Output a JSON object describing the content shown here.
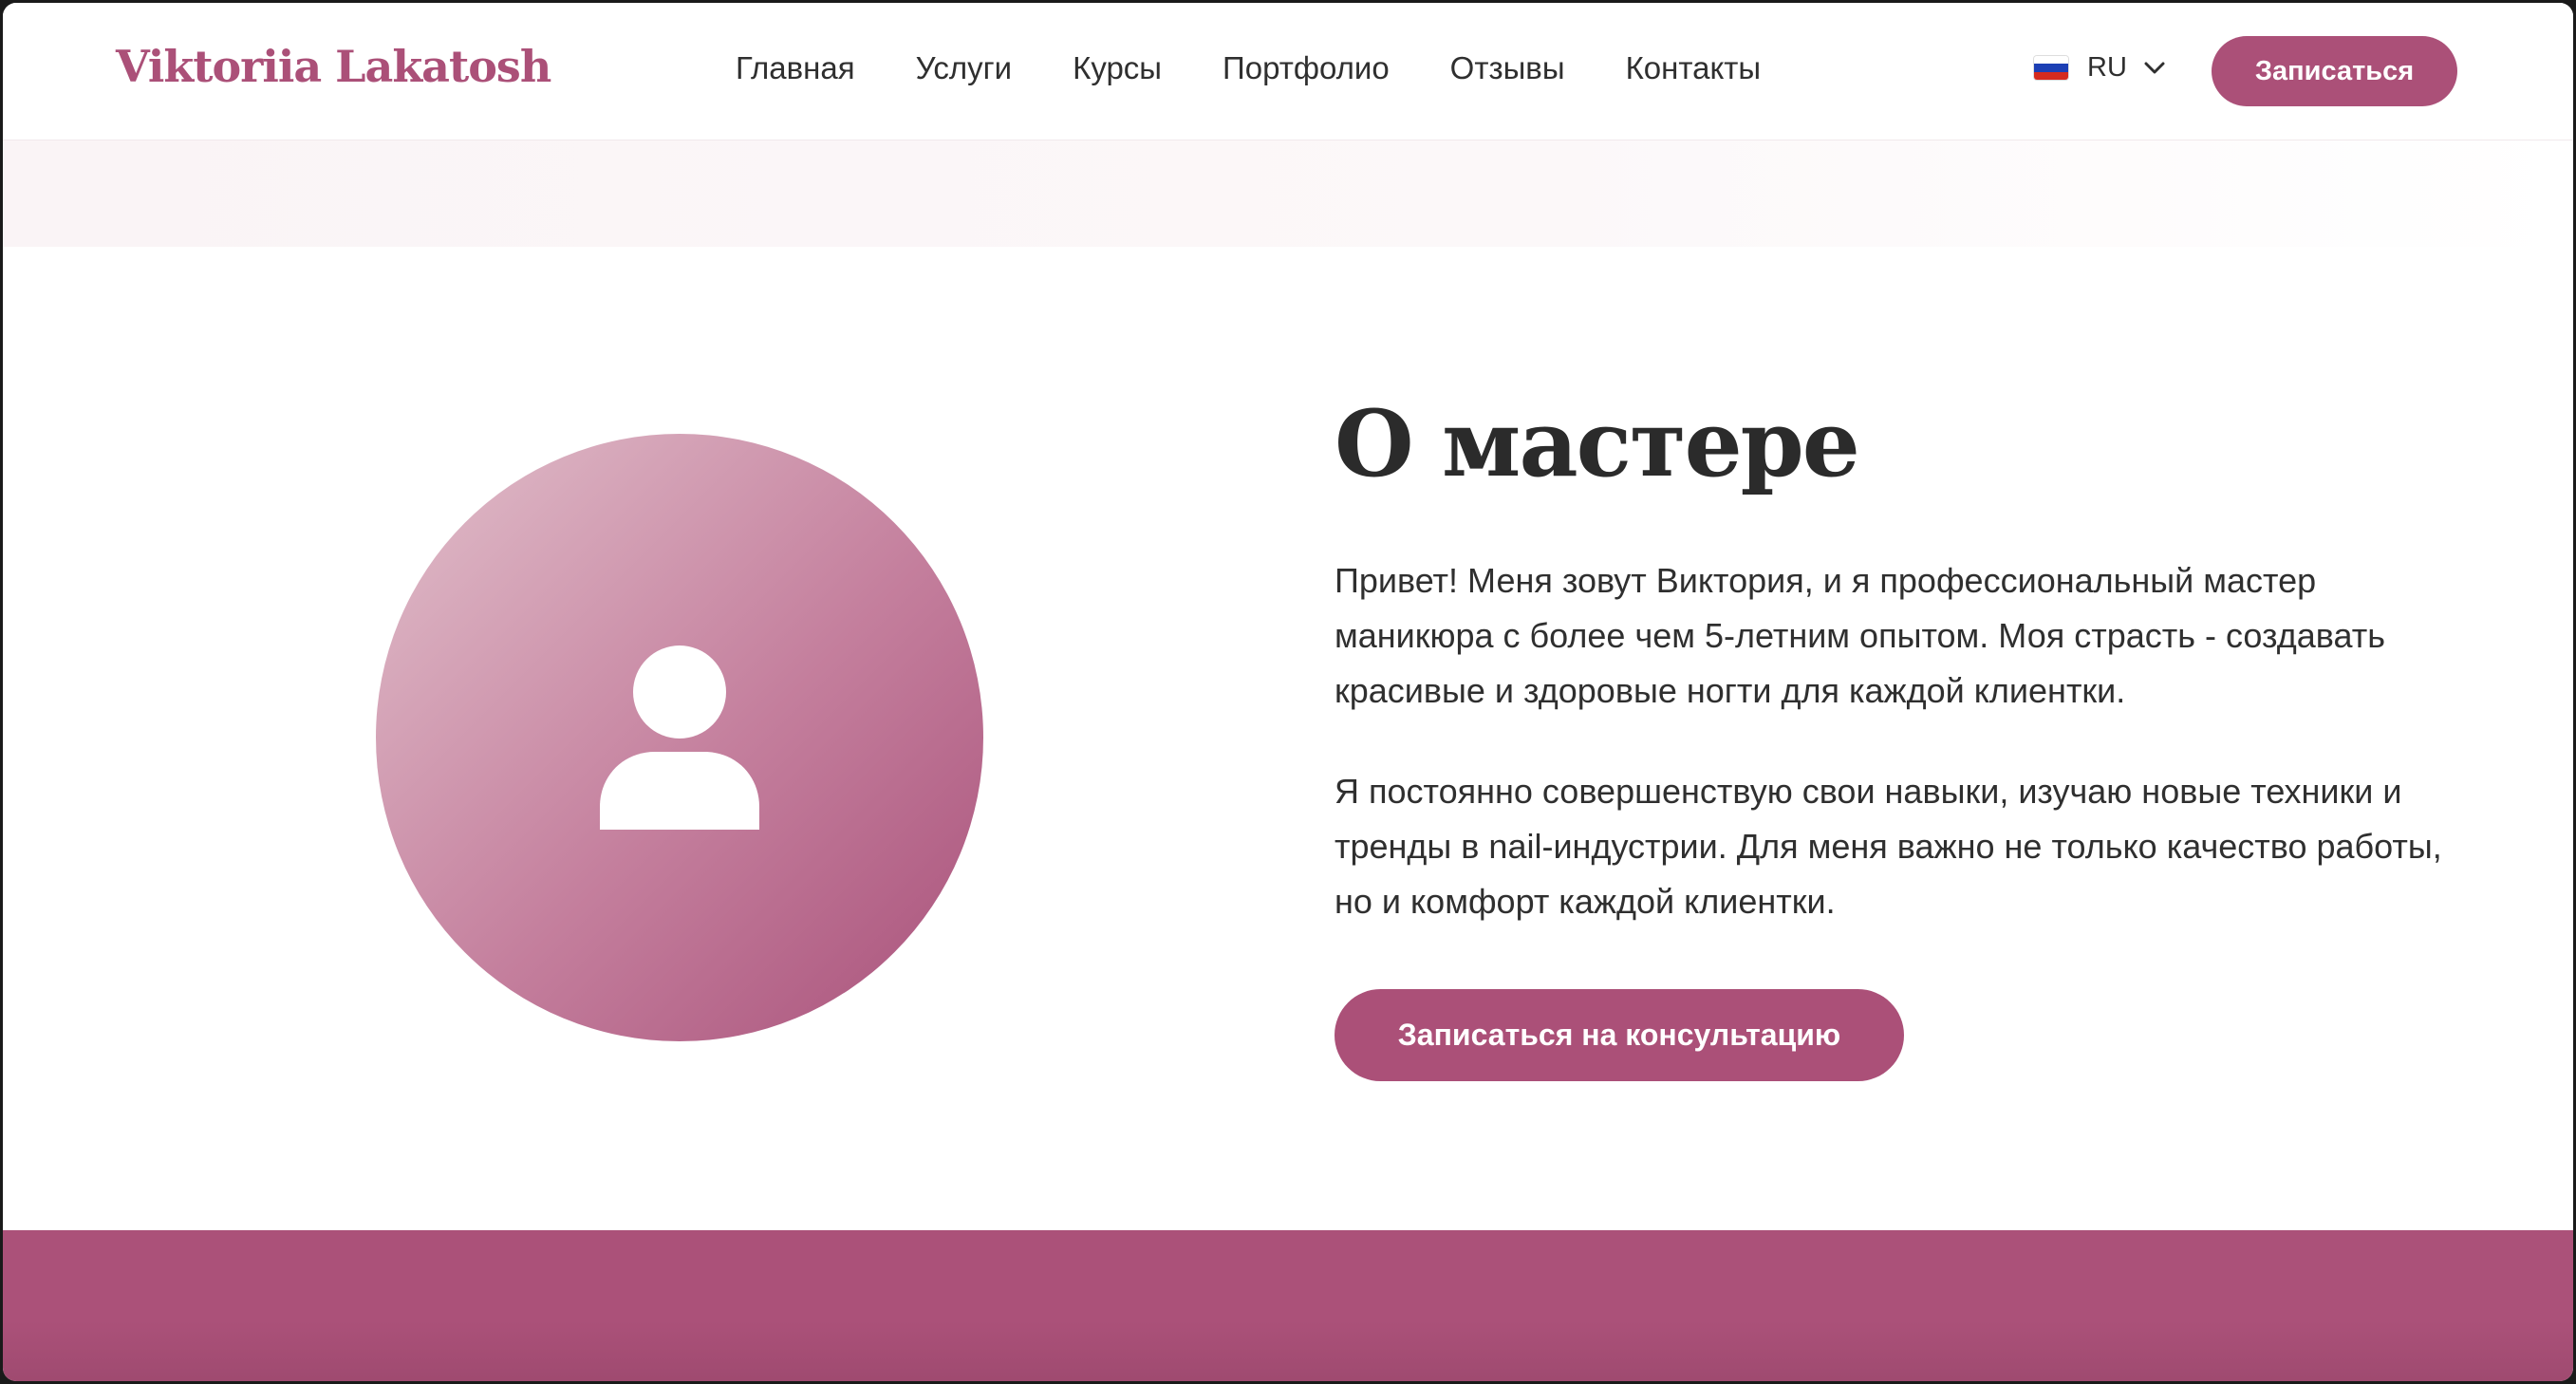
{
  "header": {
    "logo": "Viktoriia Lakatosh",
    "nav": [
      {
        "label": "Главная"
      },
      {
        "label": "Услуги"
      },
      {
        "label": "Курсы"
      },
      {
        "label": "Портфолио"
      },
      {
        "label": "Отзывы"
      },
      {
        "label": "Контакты"
      }
    ],
    "language": {
      "code": "RU",
      "flag_icon": "russia-flag-icon"
    },
    "cta_label": "Записаться"
  },
  "about": {
    "title": "О мастере",
    "paragraphs": [
      "Привет! Меня зовут Виктория, и я профессиональный мастер маникюра с более чем 5-летним опытом. Моя страсть - создавать красивые и здоровые ногти для каждой клиентки.",
      "Я постоянно совершенствую свои навыки, изучаю новые техники и тренды в nail-индустрии. Для меня важно не только качество работы, но и комфорт каждой клиентки."
    ],
    "cta_label": "Записаться на консультацию",
    "avatar_icon": "user-icon"
  },
  "colors": {
    "accent": "#ab5078",
    "text": "#2f2f2f",
    "heading": "#2b2b2b"
  }
}
